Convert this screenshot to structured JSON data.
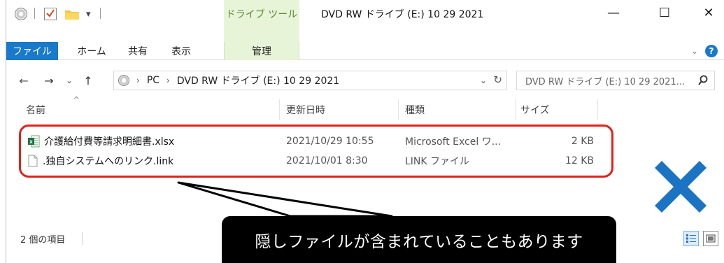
{
  "window": {
    "title": "DVD RW ドライブ (E:) 10 29 2021",
    "context_tab_title": "ドライブ ツール",
    "quick_access_dropdown": "▾",
    "minimize": "—",
    "maximize": "☐",
    "close": "✕"
  },
  "ribbon": {
    "tabs": [
      "ファイル",
      "ホーム",
      "共有",
      "表示",
      "管理"
    ],
    "collapse_chevron": "⌄",
    "help": "?"
  },
  "navigation": {
    "back": "←",
    "forward": "→",
    "recent": "⌄",
    "up": "↑",
    "breadcrumb": [
      "PC",
      "DVD RW ドライブ (E:) 10 29 2021"
    ],
    "breadcrumb_sep": "›",
    "dropdown": "⌄",
    "refresh": "↻",
    "search_placeholder": "DVD RW ドライブ (E:) 10 29 2021... "
  },
  "columns": {
    "name": "名前",
    "date": "更新日時",
    "type": "種類",
    "size": "サイズ",
    "sort_caret": "^"
  },
  "files": [
    {
      "name": "介護給付費等請求明細書.xlsx",
      "date": "2021/10/29 10:55",
      "type": "Microsoft Excel ワ...",
      "size": "2 KB",
      "icon": "excel-file-icon"
    },
    {
      "name": ".独自システムへのリンク.link",
      "date": "2021/10/01 8:30",
      "type": "LINK ファイル",
      "size": "12 KB",
      "icon": "generic-file-icon"
    }
  ],
  "status": {
    "item_count": "2 個の項目"
  },
  "callout": {
    "text": "隠しファイルが含まれていることもあります"
  },
  "colors": {
    "file_tab": "#1979ca",
    "context_tab": "#e8f4d8",
    "highlight": "#e0221b",
    "cross": "#1b73c4"
  }
}
